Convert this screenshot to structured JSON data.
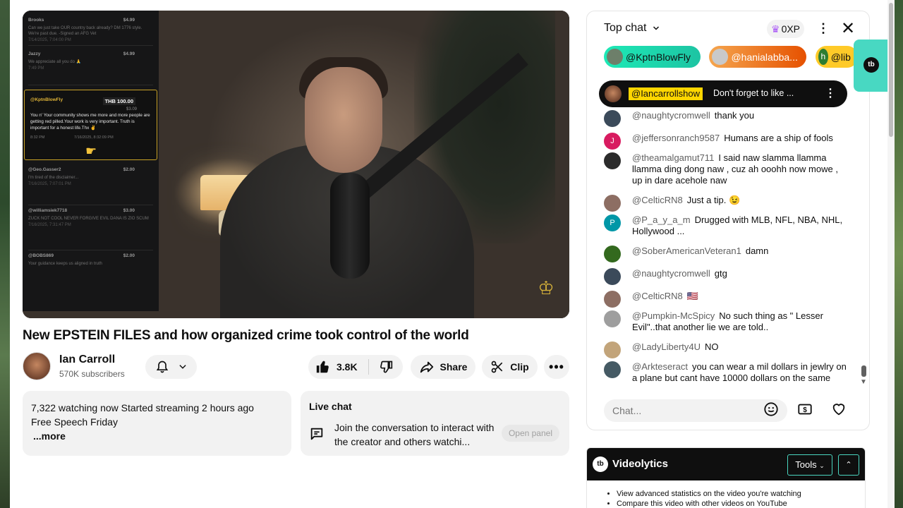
{
  "overlay": {
    "superchats": [
      {
        "name": "Brooks",
        "amount": "$4.99",
        "message": "Can we just take OUR country back already? DM 1776 style. We're past due. -Signed an AFG Vet",
        "time": "7/14/2025, 7:04:00 PM"
      },
      {
        "name": "Jazzy",
        "amount": "$4.99",
        "message": "We appreciate all you do 🙏",
        "time": "7:49 PM"
      }
    ],
    "highlight": {
      "name": "@KptnBlowFly",
      "amount": "THB 100.00",
      "sub": "$3.09",
      "message": "You n' Your community shows me more and more people are getting red pilled.Your work is very important. Truth is important for a honest life.Thx ✌️",
      "time": "8:32 PM",
      "date": "7/16/2025, 8:32:09 PM"
    },
    "superchats2": [
      {
        "name": "@Geo.Gasser2",
        "amount": "$2.00",
        "message": "I'm tired of the disclaimer...",
        "time": "7/16/2025, 7:07:01 PM"
      },
      {
        "name": "@williamsiek7718",
        "amount": "$3.00",
        "message": "ZUCK NOT COOL NEVER FORGIVE EVIL DANA IS ZIO SCUM",
        "time": "7/16/2025, 7:31:47 PM"
      },
      {
        "name": "@BOBS869",
        "amount": "$2.00",
        "message": "Your guidance keeps us aligned in truth",
        "time": ""
      }
    ]
  },
  "video": {
    "title": "New EPSTEIN FILES and how organized crime took control of the world"
  },
  "channel": {
    "name": "Ian Carroll",
    "subscribers": "570K subscribers"
  },
  "actions": {
    "likes": "3.8K",
    "share": "Share",
    "clip": "Clip"
  },
  "description": {
    "line1": "7,322 watching now  Started streaming 2 hours ago",
    "line2": "Free Speech Friday",
    "more": "...more"
  },
  "live_chat_card": {
    "title": "Live chat",
    "text": "Join the conversation to interact with the creator and others watchi...",
    "button": "Open panel"
  },
  "chat": {
    "title": "Top chat",
    "xp": "0XP",
    "tickers": [
      {
        "name": "@KptnBlowFly",
        "color": "#1de9b6"
      },
      {
        "name": "@hanialabba...",
        "color": "#e65100"
      },
      {
        "name": "@lib",
        "color": "#ffca28",
        "initial": "h"
      }
    ],
    "pinned": {
      "author": "@Iancarrollshow",
      "text": "Don't forget to like ..."
    },
    "messages": [
      {
        "author": "@naughtycromwell",
        "text": "thank you",
        "color": "#3b4a5a"
      },
      {
        "author": "@jeffersonranch9587",
        "text": "Humans are a ship of fools",
        "color": "#d81b60",
        "initial": "J"
      },
      {
        "author": "@theamalgamut711",
        "text": "I said naw slamma llamma llamma ding dong naw , cuz ah ooohh now mowe , up in dare acehole naw",
        "color": "#2b2b2b"
      },
      {
        "author": "@CelticRN8",
        "text": "Just a tip. 😉",
        "color": "#8d6e63"
      },
      {
        "author": "@P_a_y_a_m",
        "text": "Drugged with MLB, NFL, NBA, NHL, Hollywood ...",
        "color": "#0097a7",
        "initial": "P"
      },
      {
        "author": "@SoberAmericanVeteran1",
        "text": "damn",
        "color": "#33691e"
      },
      {
        "author": "@naughtycromwell",
        "text": "gtg",
        "color": "#3b4a5a"
      },
      {
        "author": "@CelticRN8",
        "text": "🇺🇸",
        "color": "#8d6e63"
      },
      {
        "author": "@Pumpkin-McSpicy",
        "text": "No such thing as \" Lesser Evil\"..that another lie we are told..",
        "color": "#9e9e9e"
      },
      {
        "author": "@LadyLiberty4U",
        "text": "NO",
        "color": "#c2a47a"
      },
      {
        "author": "@Arkteseract",
        "text": "you can wear a mil dollars in jewlry on a plane but cant have 10000 dollars on the same",
        "color": "#455a64"
      }
    ],
    "input_placeholder": "Chat..."
  },
  "videolytics": {
    "title": "Videolytics",
    "tools": "Tools",
    "bullets": [
      "View advanced statistics on the video you're watching",
      "Compare this video with other videos on YouTube"
    ]
  }
}
